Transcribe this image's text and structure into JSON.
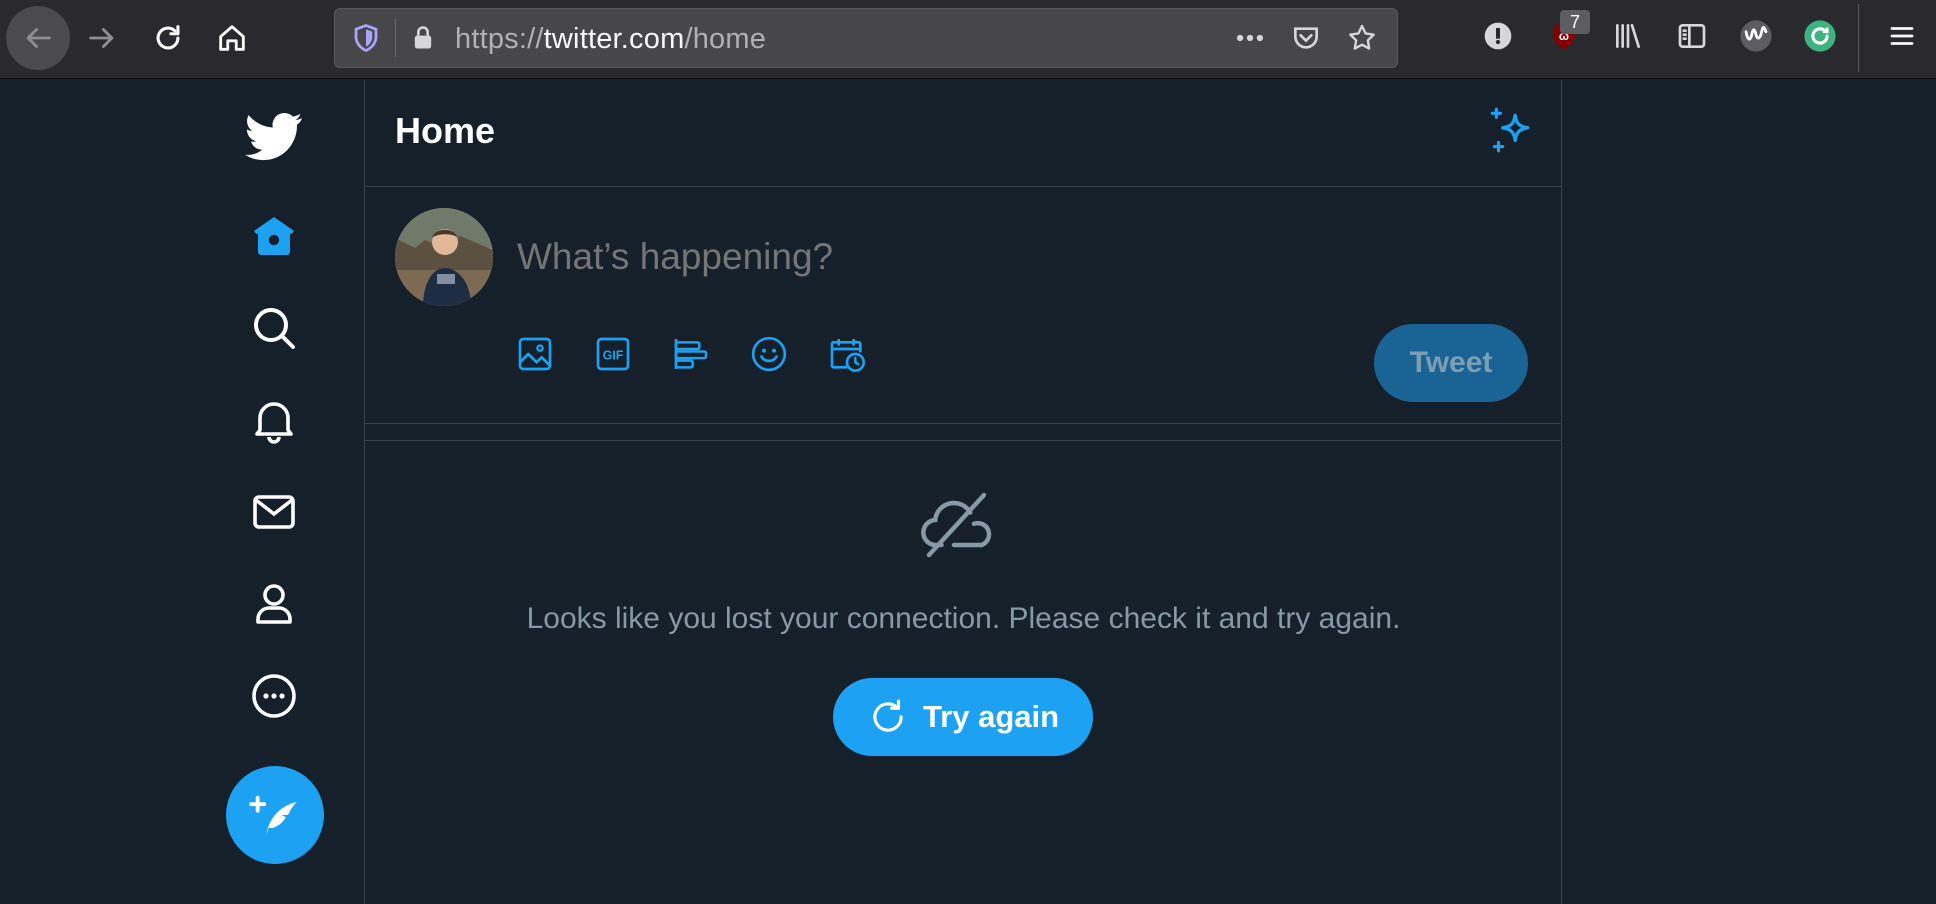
{
  "browser": {
    "url_scheme": "https://",
    "url_host": "twitter.com",
    "url_path": "/home",
    "extension_badge": "7",
    "icons": [
      "back-icon",
      "forward-icon",
      "reload-icon",
      "home-icon",
      "tracking-shield-icon",
      "lock-icon",
      "page-actions-icon",
      "pocket-icon",
      "bookmark-star-icon",
      "password-manager-icon",
      "ublock-icon",
      "library-icon",
      "sidebar-icon",
      "extension-w-icon",
      "sync-icon",
      "menu-icon"
    ]
  },
  "app": {
    "page_title": "Home",
    "accent_color": "#1da1f2",
    "background_color": "#15202b"
  },
  "sidenav": {
    "items": [
      "twitter-logo",
      "home",
      "explore",
      "notifications",
      "messages",
      "profile",
      "more"
    ]
  },
  "composer": {
    "placeholder": "What’s happening?",
    "tweet_label": "Tweet",
    "tools": [
      "image-icon",
      "gif-icon",
      "poll-icon",
      "emoji-icon",
      "schedule-icon"
    ]
  },
  "error": {
    "message": "Looks like you lost your connection. Please check it and try again.",
    "retry_label": "Try again"
  }
}
